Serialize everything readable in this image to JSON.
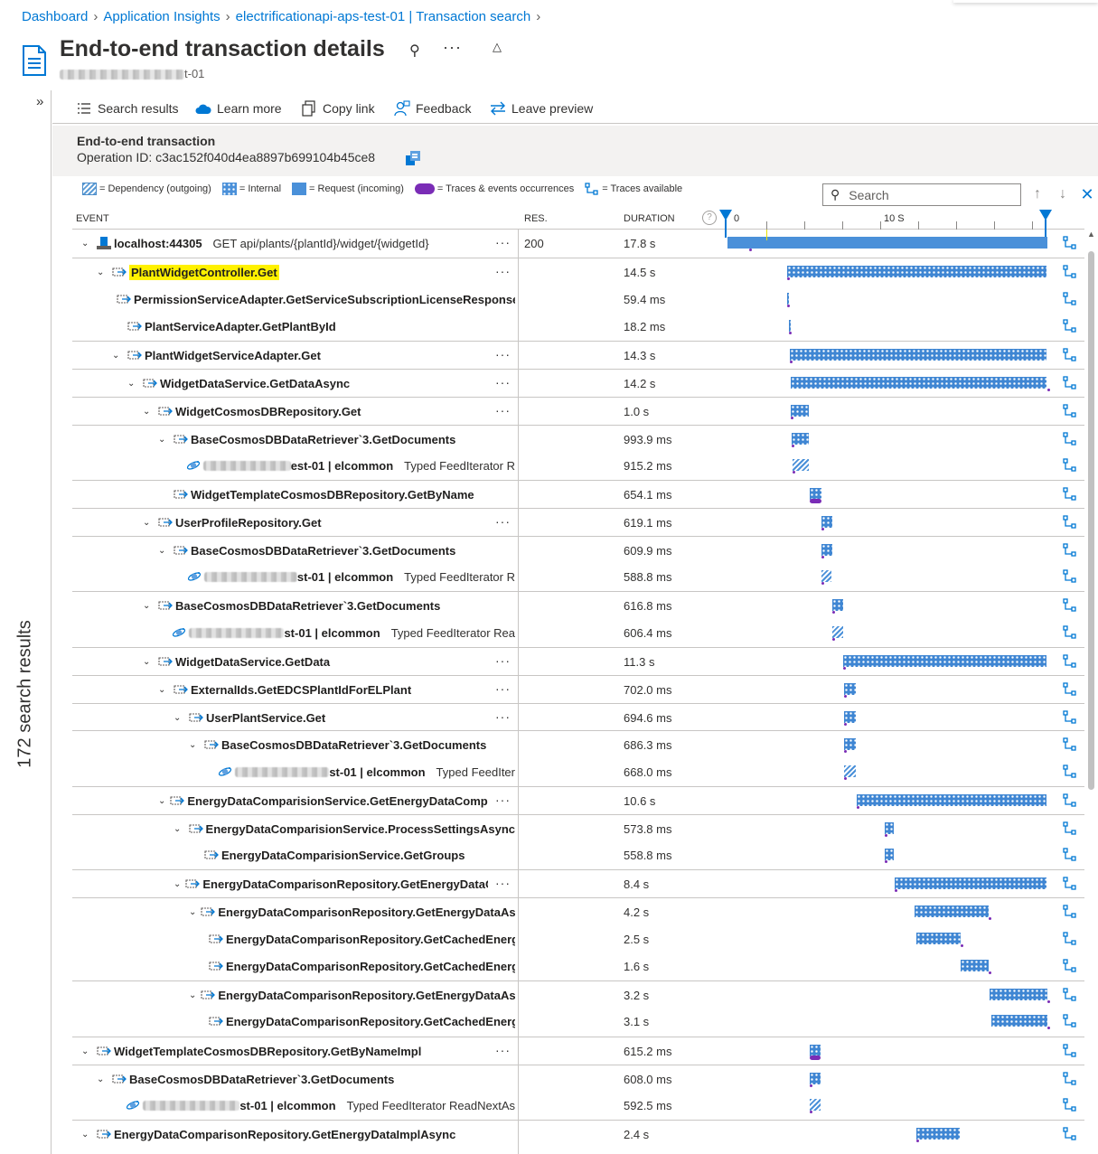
{
  "breadcrumb": [
    "Dashboard",
    "Application Insights",
    "electrificationapi-aps-test-01 | Transaction search"
  ],
  "page": {
    "title": "End-to-end transaction details",
    "subtitle_suffix": "t-01"
  },
  "toolbar": {
    "search_results": "Search results",
    "learn_more": "Learn more",
    "copy_link": "Copy link",
    "feedback": "Feedback",
    "leave_preview": "Leave preview"
  },
  "header": {
    "title": "End-to-end transaction",
    "operation_id": "Operation ID: c3ac152f040d4ea8897b699104b45ce8"
  },
  "legend": {
    "dependency": "= Dependency (outgoing)",
    "internal": "= Internal",
    "request": "= Request (incoming)",
    "traces": "= Traces & events occurrences",
    "traces_available": "= Traces available"
  },
  "search": {
    "placeholder": "Search"
  },
  "left_rail": {
    "label": "172 search results"
  },
  "grid": {
    "columns": {
      "event": "EVENT",
      "res": "RES.",
      "duration": "DURATION"
    },
    "axis": {
      "start_label": "0",
      "mid_label": "10 S"
    },
    "rows": [
      {
        "name": "localhost:44305",
        "detail": "GET api/plants/{plantId}/widget/{widgetId}",
        "res": "200",
        "duration": "17.8 s"
      },
      {
        "name": "PlantWidgetController.Get",
        "duration": "14.5 s"
      },
      {
        "name": "PermissionServiceAdapter.GetServiceSubscriptionLicenseResponse",
        "duration": "59.4 ms"
      },
      {
        "name": "PlantServiceAdapter.GetPlantById",
        "duration": "18.2 ms"
      },
      {
        "name": "PlantWidgetServiceAdapter.Get",
        "duration": "14.3 s"
      },
      {
        "name": "WidgetDataService.GetDataAsync",
        "duration": "14.2 s"
      },
      {
        "name": "WidgetCosmosDBRepository.Get",
        "duration": "1.0 s"
      },
      {
        "name": "BaseCosmosDBDataRetriever`3.GetDocuments",
        "duration": "993.9 ms"
      },
      {
        "name": "est-01 | elcommon",
        "detail": "Typed FeedIterator R",
        "duration": "915.2 ms"
      },
      {
        "name": "WidgetTemplateCosmosDBRepository.GetByName",
        "duration": "654.1 ms"
      },
      {
        "name": "UserProfileRepository.Get",
        "duration": "619.1 ms"
      },
      {
        "name": "BaseCosmosDBDataRetriever`3.GetDocuments",
        "duration": "609.9 ms"
      },
      {
        "name": "st-01 | elcommon",
        "detail": "Typed FeedIterator R",
        "duration": "588.8 ms"
      },
      {
        "name": "BaseCosmosDBDataRetriever`3.GetDocuments",
        "duration": "616.8 ms"
      },
      {
        "name": "st-01 | elcommon",
        "detail": "Typed FeedIterator Rea",
        "duration": "606.4 ms"
      },
      {
        "name": "WidgetDataService.GetData",
        "duration": "11.3 s"
      },
      {
        "name": "ExternalIds.GetEDCSPlantIdForELPlant",
        "duration": "702.0 ms"
      },
      {
        "name": "UserPlantService.Get",
        "duration": "694.6 ms"
      },
      {
        "name": "BaseCosmosDBDataRetriever`3.GetDocuments",
        "duration": "686.3 ms"
      },
      {
        "name": "st-01 | elcommon",
        "detail": "Typed FeedIter",
        "duration": "668.0 ms"
      },
      {
        "name": "EnergyDataComparisionService.GetEnergyDataCompar",
        "duration": "10.6 s"
      },
      {
        "name": "EnergyDataComparisionService.ProcessSettingsAsync",
        "duration": "573.8 ms"
      },
      {
        "name": "EnergyDataComparisionService.GetGroups",
        "duration": "558.8 ms"
      },
      {
        "name": "EnergyDataComparisonRepository.GetEnergyDataCc",
        "duration": "8.4 s"
      },
      {
        "name": "EnergyDataComparisonRepository.GetEnergyDataAsyı",
        "duration": "4.2 s"
      },
      {
        "name": "EnergyDataComparisonRepository.GetCachedEnerg",
        "duration": "2.5 s"
      },
      {
        "name": "EnergyDataComparisonRepository.GetCachedEnerg",
        "duration": "1.6 s"
      },
      {
        "name": "EnergyDataComparisonRepository.GetEnergyDataAsyı",
        "duration": "3.2 s"
      },
      {
        "name": "EnergyDataComparisonRepository.GetCachedEnerg",
        "duration": "3.1 s"
      },
      {
        "name": "WidgetTemplateCosmosDBRepository.GetByNameImpl",
        "duration": "615.2 ms"
      },
      {
        "name": "BaseCosmosDBDataRetriever`3.GetDocuments",
        "duration": "608.0 ms"
      },
      {
        "name": "st-01 | elcommon",
        "detail": "Typed FeedIterator ReadNextAs",
        "duration": "592.5 ms"
      },
      {
        "name": "EnergyDataComparisonRepository.GetEnergyDataImplAsync",
        "duration": "2.4 s"
      }
    ]
  },
  "colors": {
    "accent": "#0078d4",
    "bar": "#4a90d9",
    "trace": "#7a2cb6",
    "highlight": "#fff100"
  }
}
